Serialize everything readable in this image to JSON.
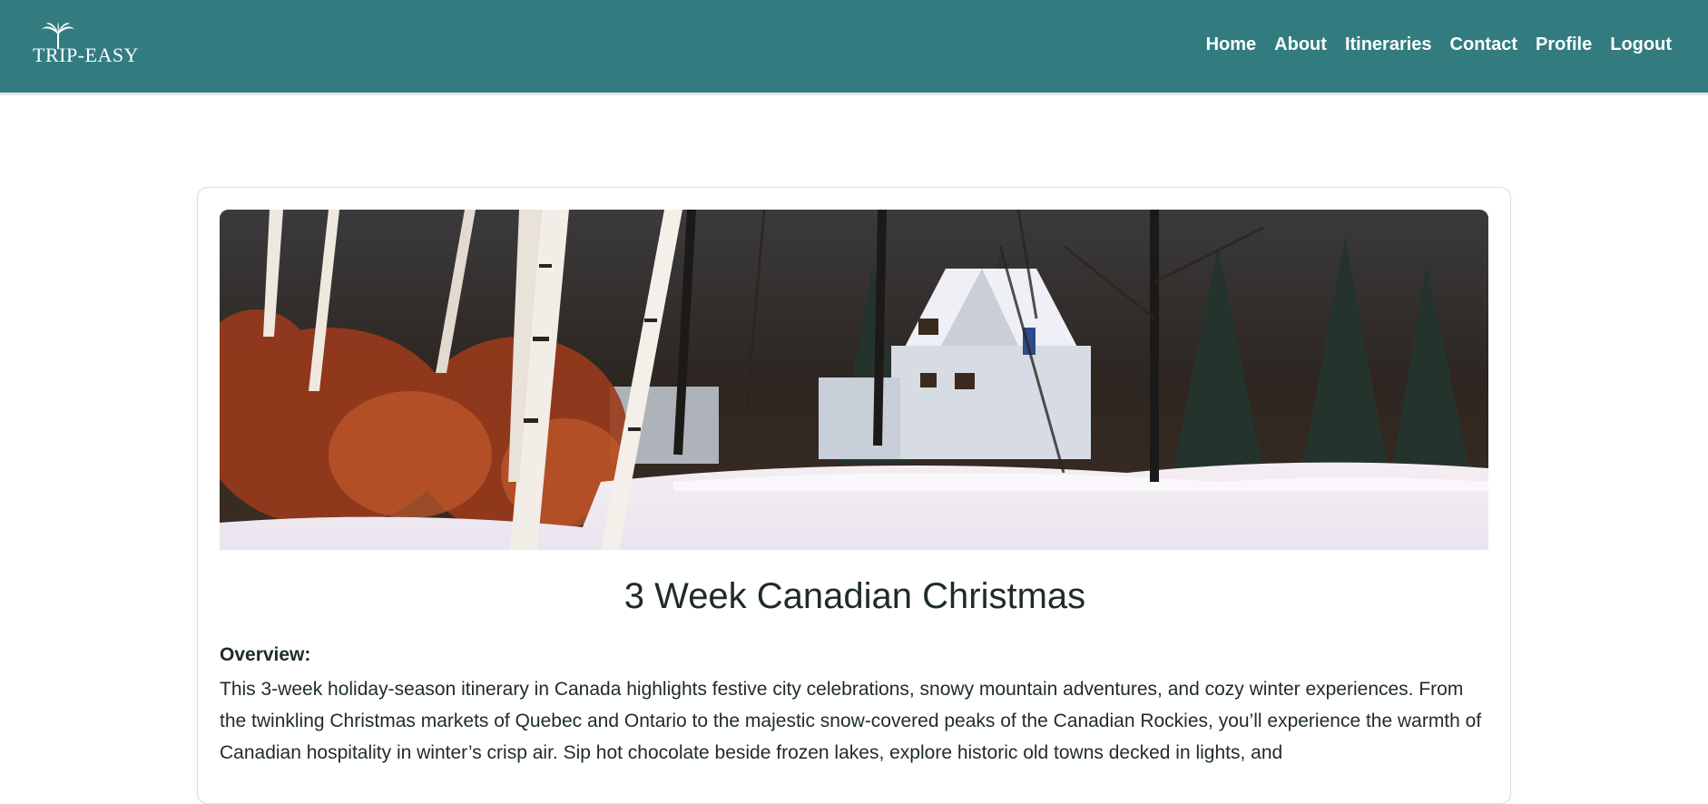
{
  "brand": {
    "logo_text": "TRIP-EASY"
  },
  "nav": {
    "items": [
      "Home",
      "About",
      "Itineraries",
      "Contact",
      "Profile",
      "Logout"
    ]
  },
  "itinerary": {
    "title": "3 Week Canadian Christmas",
    "overview_label": "Overview:",
    "overview_text": "This 3-week holiday-season itinerary in Canada highlights festive city celebrations, snowy mountain adventures, and cozy winter experiences. From the twinkling Christmas markets of Quebec and Ontario to the majestic snow-covered peaks of the Canadian Rockies, you’ll experience the warmth of Canadian hospitality in winter’s crisp air. Sip hot chocolate beside frozen lakes, explore historic old towns decked in lights, and"
  },
  "colors": {
    "navbar": "#327c80",
    "text": "#1e2c26"
  },
  "icons": {
    "logo": "palm-tree-icon"
  }
}
